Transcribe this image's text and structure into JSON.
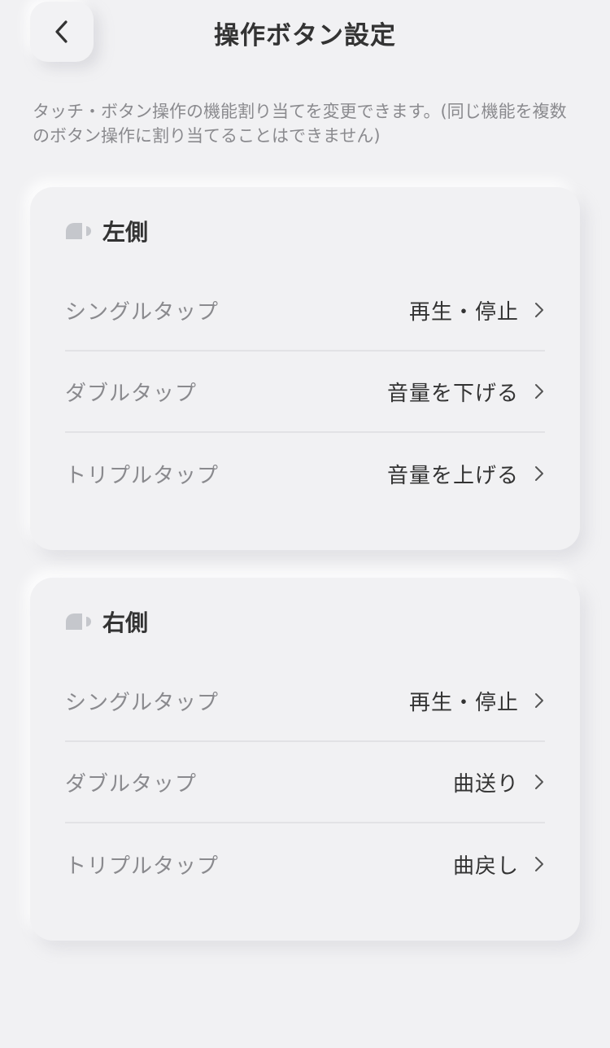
{
  "header": {
    "title": "操作ボタン設定",
    "back_icon": "chevron-left-icon"
  },
  "description": "タッチ・ボタン操作の機能割り当てを変更できます。(同じ機能を複数のボタン操作に割り当てることはできません)",
  "sections": [
    {
      "title": "左側",
      "icon": "left-earbud-icon",
      "rows": [
        {
          "label": "シングルタップ",
          "value": "再生・停止"
        },
        {
          "label": "ダブルタップ",
          "value": "音量を下げる"
        },
        {
          "label": "トリプルタップ",
          "value": "音量を上げる"
        }
      ]
    },
    {
      "title": "右側",
      "icon": "right-earbud-icon",
      "rows": [
        {
          "label": "シングルタップ",
          "value": "再生・停止"
        },
        {
          "label": "ダブルタップ",
          "value": "曲送り"
        },
        {
          "label": "トリプルタップ",
          "value": "曲戻し"
        }
      ]
    }
  ],
  "colors": {
    "background": "#f1f1f3",
    "text_primary": "#333333",
    "text_secondary": "#8a8a8e",
    "divider": "#e2e2e5",
    "icon_gray": "#c5c7cc"
  }
}
